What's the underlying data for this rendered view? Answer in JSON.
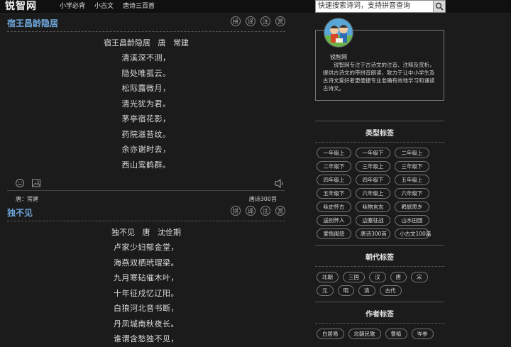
{
  "header": {
    "logo": "锐智网",
    "nav": [
      "小学必背",
      "小古文",
      "唐诗三百首"
    ],
    "search_placeholder": "快速搜索诗词，支持拼音查询"
  },
  "poems": [
    {
      "title": "宿王昌龄隐居",
      "tools": [
        "拼",
        "译",
        "注",
        "赏"
      ],
      "byline": "宿王昌龄隐居   唐   常建",
      "lines": [
        "清溪深不测，",
        "隐处唯孤云。",
        "松际露微月，",
        "清光犹为君。",
        "茅亭宿花影，",
        "药院滋苔纹。",
        "余亦谢时去，",
        "西山鸾鹤群。"
      ],
      "meta_left": "唐：常建",
      "meta_right": "唐诗300首"
    },
    {
      "title": "独不见",
      "tools": [
        "拼",
        "译",
        "注",
        "赏"
      ],
      "byline": "独不见   唐   沈佺期",
      "lines": [
        "卢家少妇郁金堂，",
        "海燕双栖玳瑁梁。",
        "九月寒砧催木叶，",
        "十年征戍忆辽阳。",
        "白狼河北音书断，",
        "丹凤城南秋夜长。",
        "谁谓含愁独不见，"
      ]
    }
  ],
  "sidebar": {
    "site_name": "锐智网",
    "site_desc": "锐智网专注于古诗文的注音、注释及赏析，提供古诗文的带拼音朗读，致力于让中小学生及古诗文爱好者更便捷专业准确有效地学习和诵读古诗文。",
    "sections": [
      {
        "title": "类型标签",
        "tags": [
          "一年级上",
          "一年级下",
          "二年级上",
          "二年级下",
          "三年级上",
          "三年级下",
          "四年级上",
          "四年级下",
          "五年级上",
          "五年级下",
          "六年级上",
          "六年级下",
          "咏史怀古",
          "咏物言志",
          "羁旅思乡",
          "送别怀人",
          "边塞征战",
          "山水田园",
          "爱情闺怨",
          "唐诗300首",
          "小古文100篇"
        ]
      },
      {
        "title": "朝代标签",
        "tags": [
          "北朝",
          "三国",
          "汉",
          "唐",
          "宋",
          "元",
          "明",
          "清",
          "古代"
        ]
      },
      {
        "title": "作者标签",
        "tags": [
          "白居易",
          "北朝民歌",
          "曹植",
          "岑参"
        ]
      }
    ]
  }
}
